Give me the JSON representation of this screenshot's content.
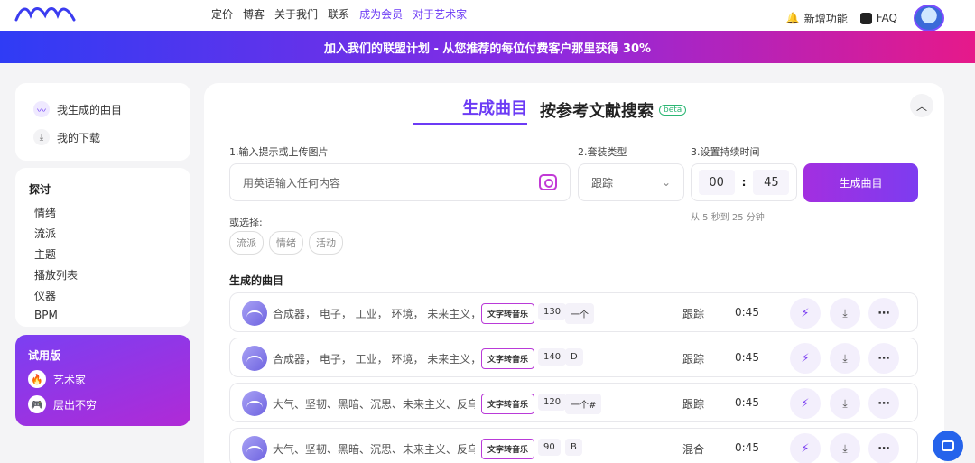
{
  "nav": {
    "items": [
      "定价",
      "博客",
      "关于我们",
      "联系",
      "成为会员",
      "对于艺术家"
    ],
    "new_features": "新增功能",
    "faq": "FAQ"
  },
  "banner": {
    "text": "加入我们的联盟计划 - 从您推荐的每位付费客户那里获得 30%"
  },
  "sidebar": {
    "top": [
      {
        "label": "我生成的曲目",
        "icon": "wave-icon"
      },
      {
        "label": "我的下载",
        "icon": "download-icon"
      }
    ],
    "explore": {
      "heading": "探讨",
      "items": [
        "情绪",
        "流派",
        "主题",
        "播放列表",
        "仪器",
        "BPM"
      ]
    },
    "trial": {
      "heading": "试用版",
      "items": [
        {
          "label": "艺术家",
          "icon": "fire-icon"
        },
        {
          "label": "层出不穷",
          "icon": "gamepad-icon"
        }
      ]
    }
  },
  "main": {
    "tab_active": "生成曲目",
    "tab_other": "按参考文献搜索",
    "beta": "beta",
    "labels": {
      "prompt": "1.输入提示或上传图片",
      "type": "2.套装类型",
      "duration": "3.设置持续时间"
    },
    "prompt_placeholder": "用英语输入任何内容",
    "select_value": "跟踪",
    "time": {
      "min": "00",
      "sep": ":",
      "sec": "45"
    },
    "generate": "生成曲目",
    "hint": "从 5 秒到 25 分钟",
    "or_choose": "或选择:",
    "chips": [
      "流派",
      "情绪",
      "活动"
    ],
    "section": "生成的曲目",
    "tracks": [
      {
        "tags": "合成器， 电子， 工业， 环境， 未来主义， 严酷",
        "badge": "文字转音乐",
        "bpm": "130",
        "key": "一个",
        "type": "跟踪",
        "duration": "0:45"
      },
      {
        "tags": "合成器， 电子， 工业， 环境， 未来主义， 严酷",
        "badge": "文字转音乐",
        "bpm": "140",
        "key": "D",
        "type": "跟踪",
        "duration": "0:45"
      },
      {
        "tags": "大气、坚韧、黑暗、沉思、未来主义、反乌托邦",
        "badge": "文字转音乐",
        "bpm": "120",
        "key": "一个#",
        "type": "跟踪",
        "duration": "0:45"
      },
      {
        "tags": "大气、坚韧、黑暗、沉思、未来主义、反乌托邦",
        "badge": "文字转音乐",
        "bpm": "90",
        "key": "B",
        "type": "混合",
        "duration": "0:45"
      }
    ]
  },
  "colors": {
    "accent": "#6c3bf5",
    "magenta": "#b02ad6",
    "chat": "#2563eb"
  }
}
